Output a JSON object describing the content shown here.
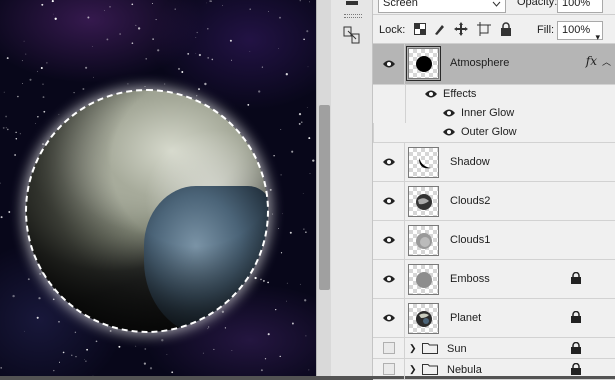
{
  "options_bar": {
    "blend_mode": "Screen",
    "opacity_label": "Opacity:",
    "opacity_value": "100%",
    "lock_label": "Lock:",
    "fill_label": "Fill:",
    "fill_value": "100%"
  },
  "layers": [
    {
      "name": "Atmosphere",
      "selected": true,
      "fx": "fx"
    },
    {
      "name": "Shadow"
    },
    {
      "name": "Clouds2"
    },
    {
      "name": "Clouds1"
    },
    {
      "name": "Emboss",
      "locked": true
    },
    {
      "name": "Planet",
      "locked": true
    }
  ],
  "effects": {
    "title": "Effects",
    "items": [
      "Inner Glow",
      "Outer Glow"
    ]
  },
  "groups": [
    {
      "name": "Sun",
      "locked": true
    },
    {
      "name": "Nebula",
      "locked": true
    }
  ],
  "colors": {
    "panel_bg": "#f0f0f0",
    "selected_layer": "#b5b5b5",
    "canvas_bg": "#08071a"
  }
}
